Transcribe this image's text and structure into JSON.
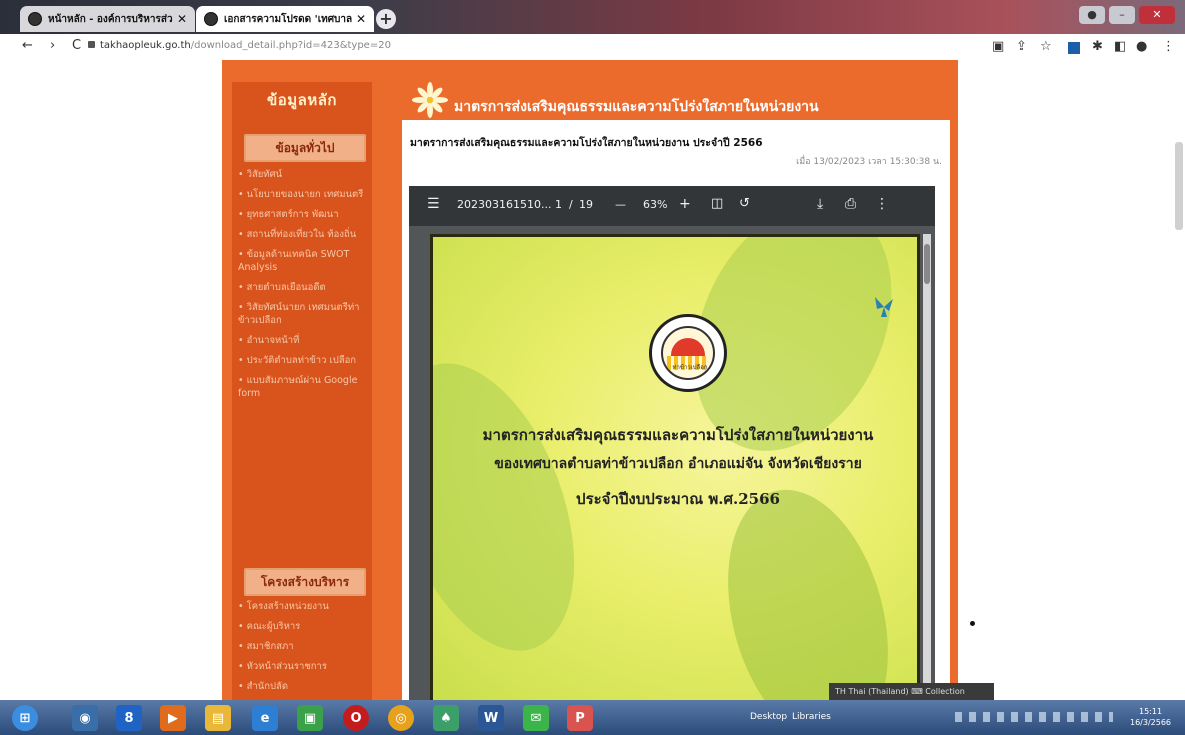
{
  "browser": {
    "tabs": [
      {
        "title": "หน้าหลัก - องค์การบริหารส่วนต...",
        "close": "✕"
      },
      {
        "title": "เอกสารความโปรดด 'เทศบาลตำบล",
        "close": "✕"
      }
    ],
    "new_tab": "+",
    "url_host": "takhaopleuk.go.th",
    "url_path": "/download_detail.php?id=423&type=20"
  },
  "site": {
    "sidebar_title": "ข้อมูลหลัก",
    "general_heading": "ข้อมูลทั่วไป",
    "general_items": [
      "วิสัยทัศน์",
      "นโยบายของนายก เทศมนตรี",
      "ยุทธศาสตร์การ พัฒนา",
      "สถานที่ท่องเที่ยวใน ท้องถิ่น",
      "ข้อมูลด้านเทคนิค SWOT Analysis",
      "สายตำบลเยือนอดีต",
      "วิสัยทัศน์นายก เทศมนตรีท่าข้าวเปลือก",
      "อำนาจหน้าที่",
      "ประวัติตำบลท่าข้าว เปลือก",
      "แบบสัมภาษณ์ผ่าน Google form"
    ],
    "admin_heading": "โครงสร้างบริหาร",
    "admin_items": [
      "โครงสร้างหน่วยงาน",
      "คณะผู้บริหาร",
      "สมาชิกสภา",
      "หัวหน้าส่วนราชการ",
      "สำนักปลัด"
    ],
    "panel_heading": "มาตรการส่งเสริมคุณธรรมและความโปร่งใสภายในหน่วยงาน",
    "doc_title": "มาตราการส่งเสริมคุณธรรมและความโปร่งใสภายในหน่วยงาน ประจำปี 2566",
    "doc_date": "เมื่อ 13/02/2023 เวลา 15:30:38 น."
  },
  "pdf": {
    "menu_icon": "☰",
    "filename": "202303161510...",
    "page_current": "1",
    "page_sep": "/",
    "page_total": "19",
    "zoom_out": "—",
    "zoom": "63%",
    "zoom_in": "+",
    "download": "⤓",
    "print": "⎙",
    "more": "⋮",
    "seal_caption": "ท่าข้าวเปลือก",
    "doc_lines": [
      "มาตรการส่งเสริมคุณธรรมและความโปร่งใสภายในหน่วยงาน",
      "ของเทศบาลตำบลท่าข้าวเปลือก อำเภอแม่จัน จังหวัดเชียงราย",
      "ประจำปีงบประมาณ พ.ศ.2566"
    ]
  },
  "taskbar": {
    "desktop_label": "Desktop",
    "libraries_label": "Libraries",
    "tooltip": "TH Thai (Thailand)  ⌨ Collection",
    "time": "15:11",
    "date": "16/3/2566"
  }
}
